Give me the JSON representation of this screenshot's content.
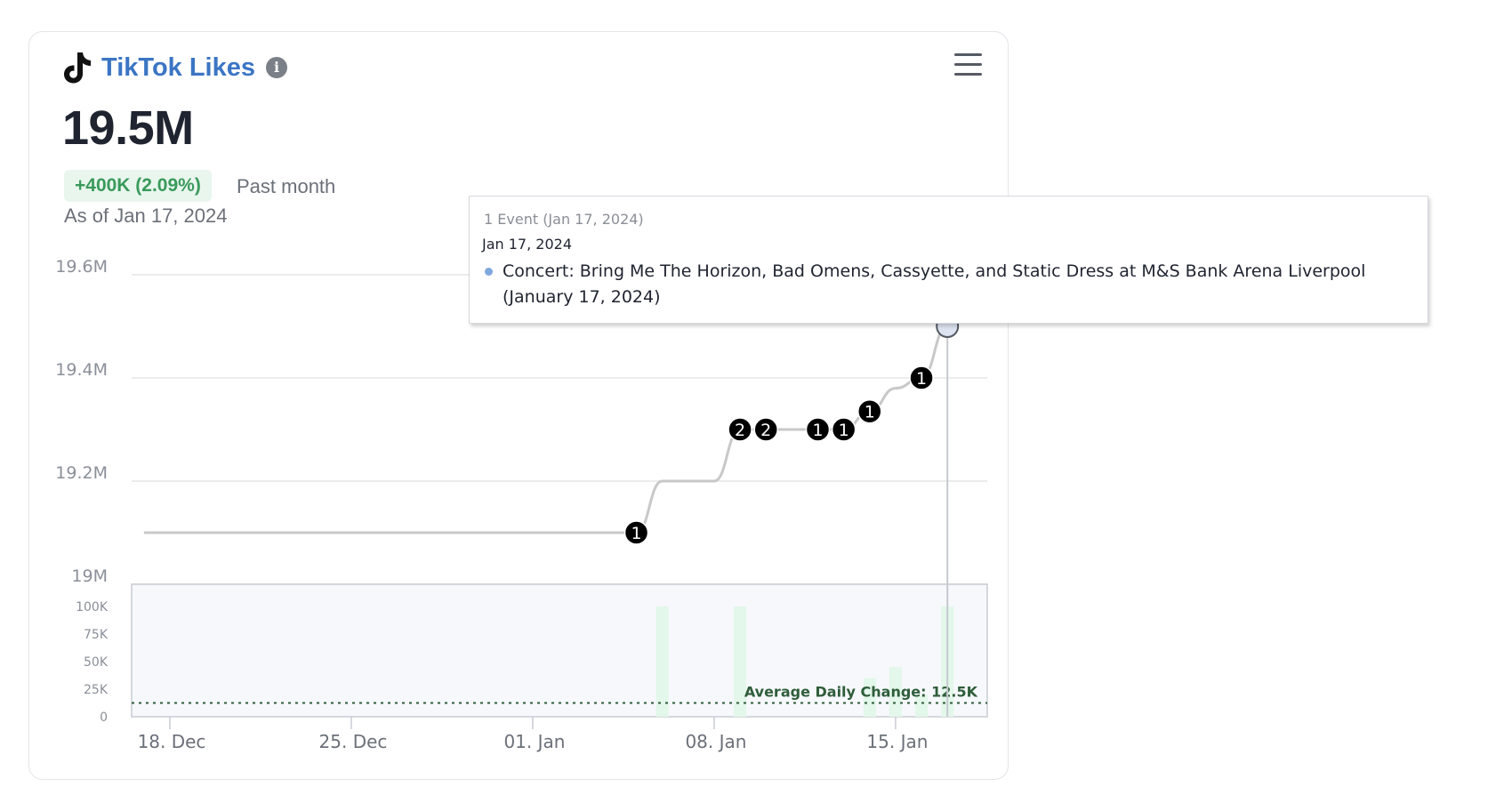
{
  "widget": {
    "title": "TikTok Likes",
    "icon": "tiktok-icon",
    "info_icon": "info-icon",
    "menu_icon": "hamburger-menu-icon",
    "value": "19.5M",
    "change": "+400K (2.09%)",
    "period": "Past month",
    "as_of": "As of Jan 17, 2024",
    "colors": {
      "title": "#3b75c4",
      "change_text": "#3a9a5b",
      "change_bg": "#e9f6ee",
      "line": "#c8c8c8",
      "bars": "#e3f7ea",
      "avg_line": "#2f5d3a"
    }
  },
  "tooltip": {
    "header": "1 Event (Jan 17, 2024)",
    "date": "Jan 17, 2024",
    "text": "Concert: Bring Me The Horizon, Bad Omens, Cassyette, and Static Dress at M&S Bank Arena Liverpool (January 17, 2024)"
  },
  "chart_data": [
    {
      "type": "line",
      "title": "",
      "x_type": "date",
      "x_range": [
        "2023-12-17",
        "2024-01-18"
      ],
      "y_range": [
        19000000,
        19600000
      ],
      "y_ticks": [
        19000000,
        19200000,
        19400000,
        19600000
      ],
      "y_tick_labels": [
        "19M",
        "19.2M",
        "19.4M",
        "19.6M"
      ],
      "x_ticks": [
        "2023-12-18",
        "2023-12-25",
        "2024-01-01",
        "2024-01-08",
        "2024-01-15"
      ],
      "x_tick_labels": [
        "18. Dec",
        "25. Dec",
        "01. Jan",
        "08. Jan",
        "15. Jan"
      ],
      "grid": true,
      "series": [
        {
          "points": [
            [
              "2023-12-17",
              19100000
            ],
            [
              "2023-12-20",
              19100000
            ],
            [
              "2023-12-25",
              19100000
            ],
            [
              "2023-12-30",
              19100000
            ],
            [
              "2024-01-05",
              19100000
            ],
            [
              "2024-01-06",
              19200000
            ],
            [
              "2024-01-07",
              19200000
            ],
            [
              "2024-01-08",
              19200000
            ],
            [
              "2024-01-09",
              19300000
            ],
            [
              "2024-01-10",
              19300000
            ],
            [
              "2024-01-11",
              19300000
            ],
            [
              "2024-01-12",
              19300000
            ],
            [
              "2024-01-13",
              19300000
            ],
            [
              "2024-01-14",
              19335000
            ],
            [
              "2024-01-15",
              19380000
            ],
            [
              "2024-01-16",
              19400000
            ],
            [
              "2024-01-17",
              19500000
            ]
          ]
        }
      ],
      "event_markers": [
        {
          "x": "2024-01-05",
          "y": 19100000,
          "label": "1"
        },
        {
          "x": "2024-01-09",
          "y": 19300000,
          "label": "2"
        },
        {
          "x": "2024-01-10",
          "y": 19300000,
          "label": "2"
        },
        {
          "x": "2024-01-12",
          "y": 19300000,
          "label": "1"
        },
        {
          "x": "2024-01-13",
          "y": 19300000,
          "label": "1"
        },
        {
          "x": "2024-01-14",
          "y": 19335000,
          "label": "1"
        },
        {
          "x": "2024-01-16",
          "y": 19400000,
          "label": "1"
        }
      ],
      "highlight_point": {
        "x": "2024-01-17",
        "y": 19500000
      }
    },
    {
      "type": "bar",
      "title": "",
      "y_range": [
        0,
        100000
      ],
      "y_ticks": [
        0,
        25000,
        50000,
        75000,
        100000
      ],
      "y_tick_labels": [
        "0",
        "25K",
        "50K",
        "75K",
        "100K"
      ],
      "bars": [
        {
          "x": "2024-01-06",
          "value": 100000
        },
        {
          "x": "2024-01-09",
          "value": 100000
        },
        {
          "x": "2024-01-14",
          "value": 35000
        },
        {
          "x": "2024-01-15",
          "value": 45000
        },
        {
          "x": "2024-01-16",
          "value": 20000
        },
        {
          "x": "2024-01-17",
          "value": 100000
        }
      ],
      "average_line": {
        "value": 12500,
        "label": "Average Daily Change: 12.5K"
      }
    }
  ]
}
